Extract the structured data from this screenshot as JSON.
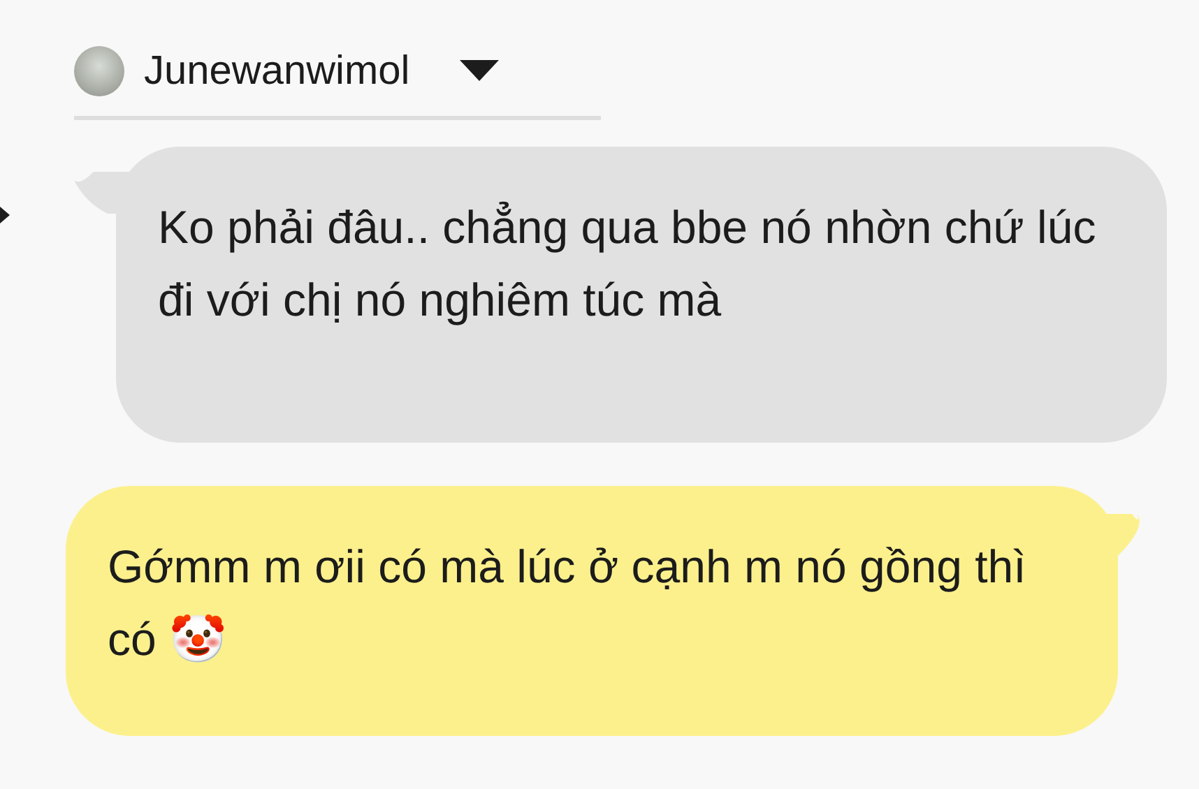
{
  "author": {
    "name": "Junewanwimol"
  },
  "messages": [
    {
      "kind": "received",
      "text": "Ko phải đâu.. chẳng qua bbe nó nhờn chứ lúc đi với chị nó nghiêm túc mà"
    },
    {
      "kind": "sent",
      "text": "Gớmm m ơii có mà lúc ở cạnh m nó gồng thì có 🤡"
    }
  ]
}
